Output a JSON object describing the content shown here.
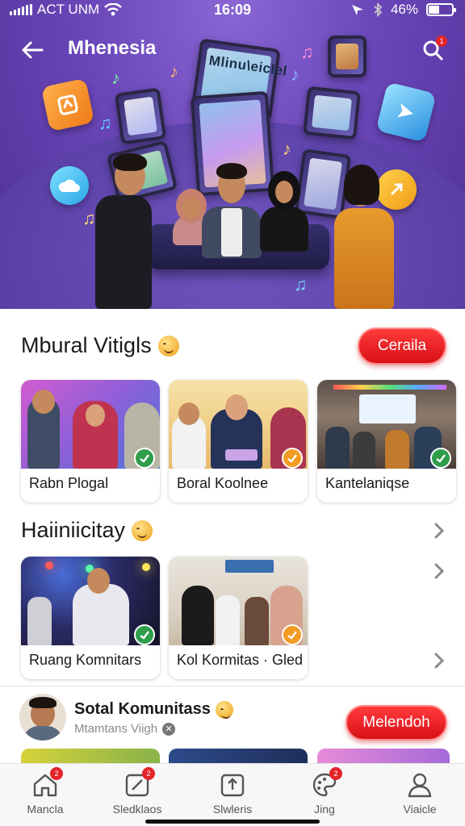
{
  "status_bar": {
    "carrier": "ACT UNM",
    "time": "16:09",
    "battery_percent": "46%",
    "battery_level": 0.46
  },
  "header": {
    "title": "Mhenesia",
    "back_icon": "arrow-left-icon",
    "search_icon": "search-icon",
    "search_badge": "1"
  },
  "hero": {
    "screen_text": "Mlinu\\eiclel"
  },
  "section1": {
    "title": "Mbural Vitigls",
    "button_label": "Ceraila",
    "cards": [
      {
        "label": "Rabn Plogal"
      },
      {
        "label": "Boral Koolnee"
      },
      {
        "label": "Kantelaniqse"
      }
    ]
  },
  "section2": {
    "title": "Haiiniicitay",
    "cards": [
      {
        "label": "Ruang Komnitars"
      },
      {
        "label": "Kol Kormitas · Gled"
      }
    ]
  },
  "feed": {
    "title": "Sotal Komunitass",
    "subtitle": "Mtamtans Viigh",
    "button_label": "Melendoh"
  },
  "bottom_nav": [
    {
      "label": "Mancla",
      "icon": "home-icon",
      "badge": "2"
    },
    {
      "label": "Sledklaos",
      "icon": "edit-box-icon",
      "badge": "2"
    },
    {
      "label": "Slwleris",
      "icon": "upload-icon",
      "badge": ""
    },
    {
      "label": "Jing",
      "icon": "palette-icon",
      "badge": "2"
    },
    {
      "label": "Viaicle",
      "icon": "profile-icon",
      "badge": ""
    }
  ],
  "colors": {
    "accent_red": "#e3242b",
    "hero_purple": "#6a46b8"
  }
}
